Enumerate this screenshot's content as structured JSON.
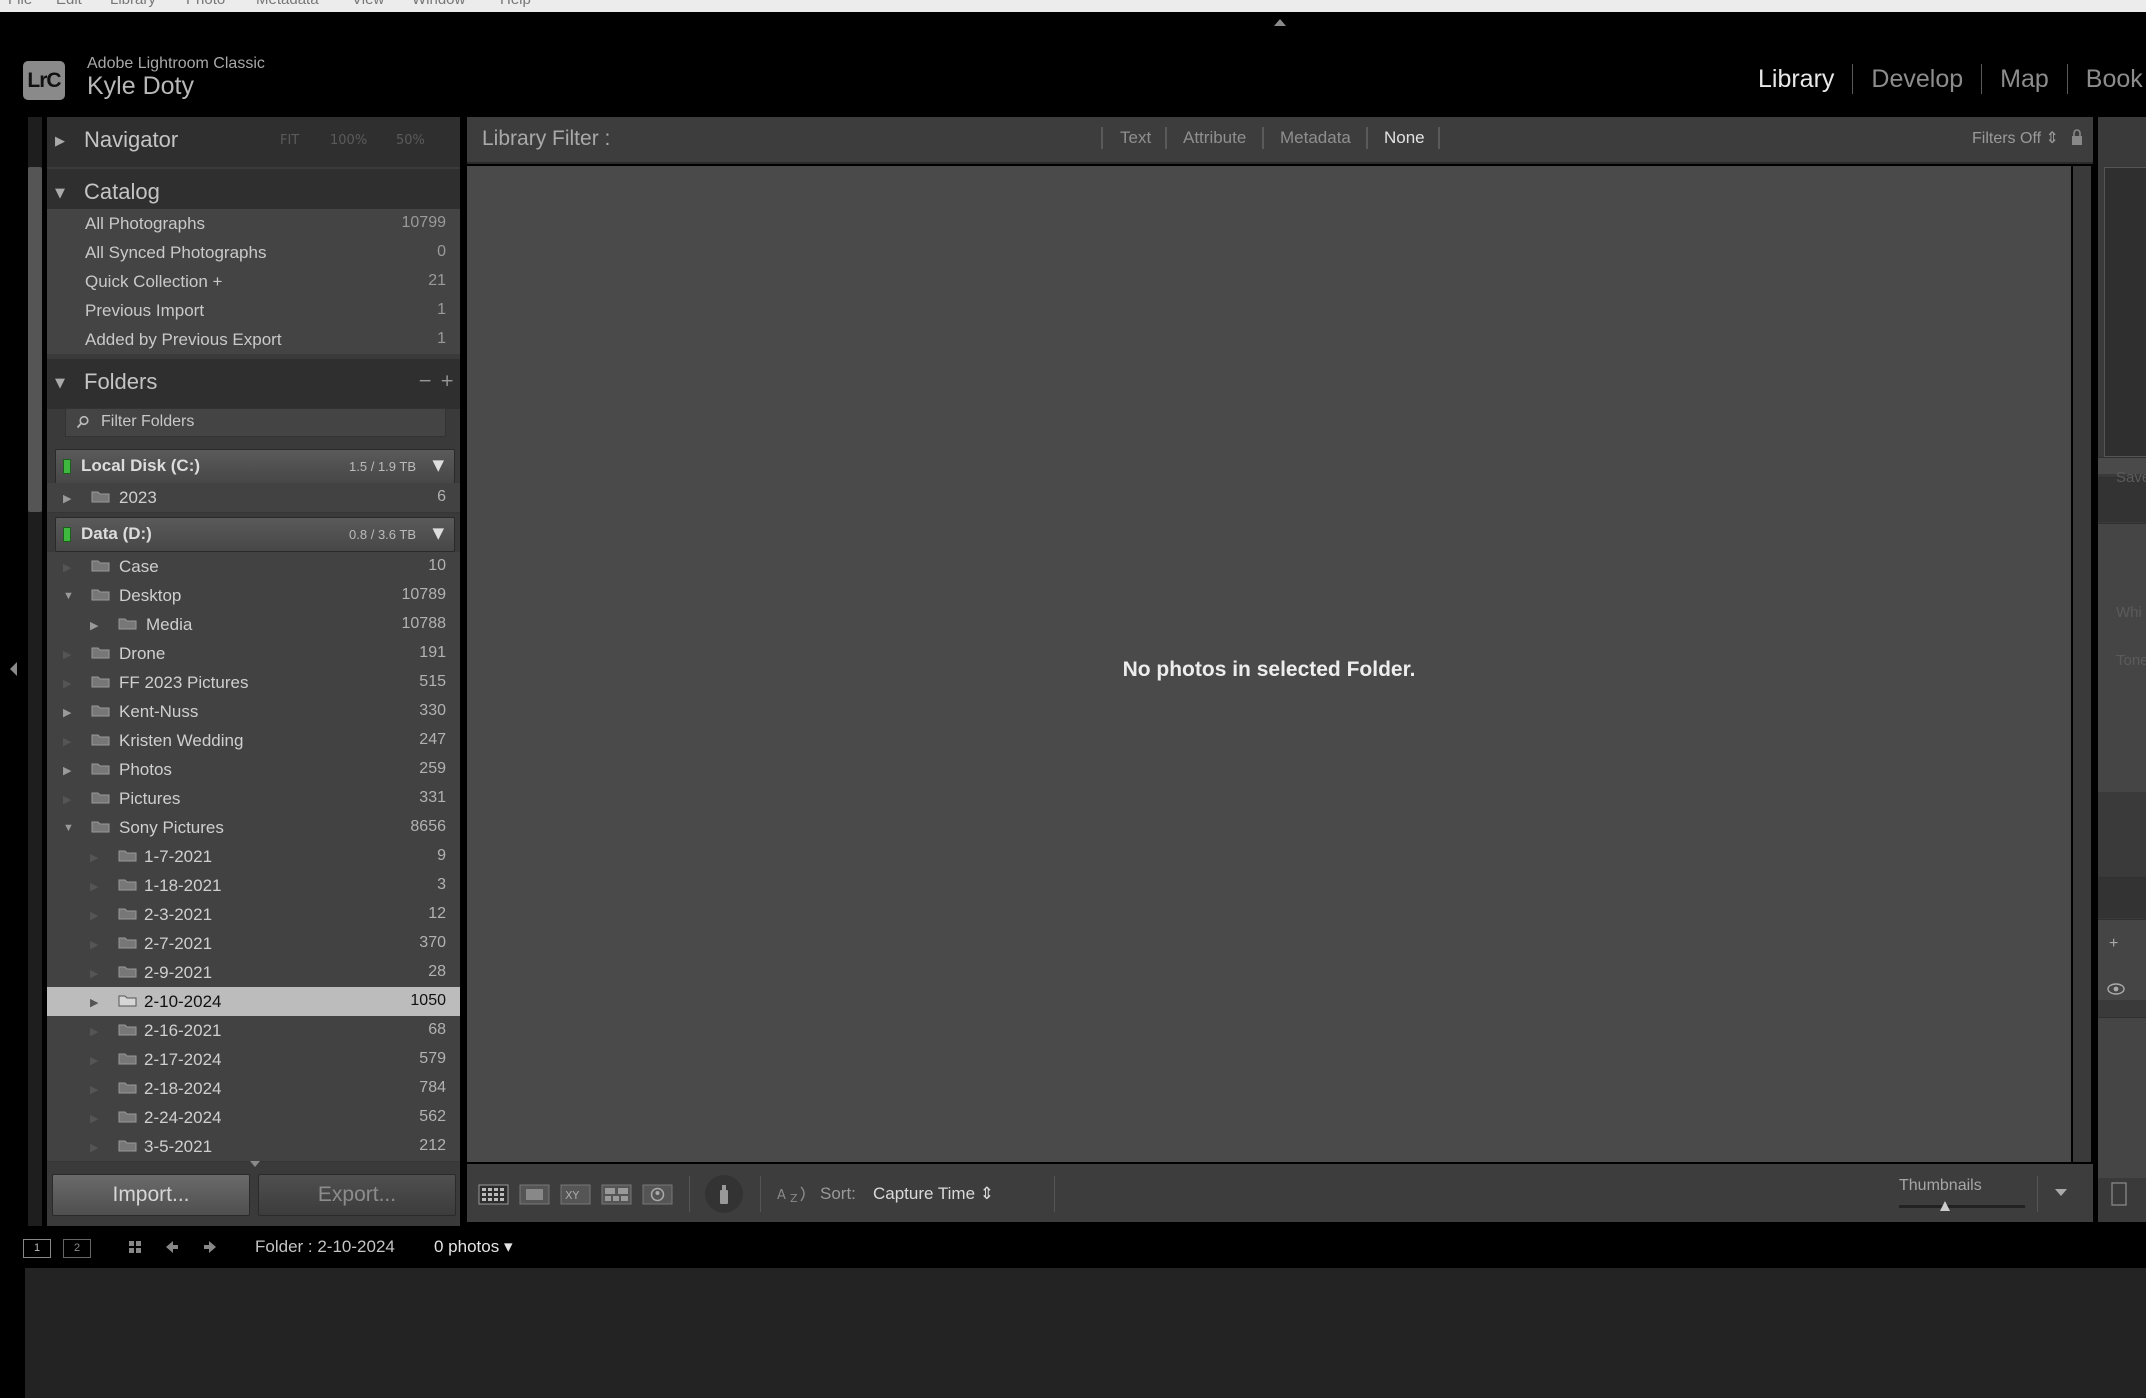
{
  "menu": [
    "File",
    "Edit",
    "Library",
    "Photo",
    "Metadata",
    "View",
    "Window",
    "Help"
  ],
  "identity": {
    "logo": "LrC",
    "app_name": "Adobe Lightroom Classic",
    "user_name": "Kyle Doty"
  },
  "modules": [
    "Library",
    "Develop",
    "Map",
    "Book"
  ],
  "active_module": "Library",
  "navigator": {
    "title": "Navigator",
    "zoom_options": [
      "FIT",
      "100%",
      "50%"
    ]
  },
  "catalog": {
    "title": "Catalog",
    "items": [
      {
        "label": "All Photographs",
        "count": "10799"
      },
      {
        "label": "All Synced Photographs",
        "count": "0"
      },
      {
        "label": "Quick Collection  +",
        "count": "21"
      },
      {
        "label": "Previous Import",
        "count": "1"
      },
      {
        "label": "Added by Previous Export",
        "count": "1"
      }
    ]
  },
  "folders": {
    "title": "Folders",
    "remove_icon": "minus-icon",
    "add_icon": "plus-icon",
    "filter_placeholder": "Filter Folders",
    "volumes": [
      {
        "name": "Local Disk (C:)",
        "size": "1.5 / 1.9 TB",
        "status_color": "#3fb83f"
      },
      {
        "name": "Data  (D:)",
        "size": "0.8 / 3.6 TB",
        "status_color": "#3fb83f"
      }
    ],
    "rows": [
      {
        "name": "2023",
        "count": "6"
      },
      {
        "name": "Case",
        "count": "10"
      },
      {
        "name": "Desktop",
        "count": "10789"
      },
      {
        "name": "Media",
        "count": "10788"
      },
      {
        "name": "Drone",
        "count": "191"
      },
      {
        "name": "FF 2023 Pictures",
        "count": "515"
      },
      {
        "name": "Kent-Nuss",
        "count": "330"
      },
      {
        "name": "Kristen Wedding",
        "count": "247"
      },
      {
        "name": "Photos",
        "count": "259"
      },
      {
        "name": "Pictures",
        "count": "331"
      },
      {
        "name": "Sony Pictures",
        "count": "8656"
      },
      {
        "name": "1-7-2021",
        "count": "9"
      },
      {
        "name": "1-18-2021",
        "count": "3"
      },
      {
        "name": "2-3-2021",
        "count": "12"
      },
      {
        "name": "2-7-2021",
        "count": "370"
      },
      {
        "name": "2-9-2021",
        "count": "28"
      },
      {
        "name": "2-10-2024",
        "count": "1050"
      },
      {
        "name": "2-16-2021",
        "count": "68"
      },
      {
        "name": "2-17-2024",
        "count": "579"
      },
      {
        "name": "2-18-2024",
        "count": "784"
      },
      {
        "name": "2-24-2024",
        "count": "562"
      },
      {
        "name": "3-5-2021",
        "count": "212"
      }
    ],
    "selected": "2-10-2024"
  },
  "buttons": {
    "import": "Import...",
    "export": "Export..."
  },
  "library_filter": {
    "title": "Library Filter :",
    "tabs": [
      "Text",
      "Attribute",
      "Metadata",
      "None"
    ],
    "active": "None",
    "filters_off": "Filters Off ⇕"
  },
  "grid": {
    "empty_message": "No photos in selected Folder."
  },
  "toolbar": {
    "view_modes": [
      "grid-view-icon",
      "loupe-view-icon",
      "compare-view-icon",
      "survey-view-icon",
      "people-view-icon"
    ],
    "sort_label": "Sort:",
    "sort_value": "Capture Time ⇕",
    "thumbnails_label": "Thumbnails"
  },
  "right_panel_fragments": [
    "Save",
    "Whi",
    "Tone",
    "+"
  ],
  "filmstrip": {
    "monitor_buttons": [
      "1",
      "2"
    ],
    "folder_label": "Folder : 2-10-2024",
    "photo_count": "0 photos ▾"
  },
  "colors": {
    "selected_row": "#bcbcbc",
    "grid_bg": "#4a4a4a",
    "panel_bg": "#3a3a3a"
  }
}
